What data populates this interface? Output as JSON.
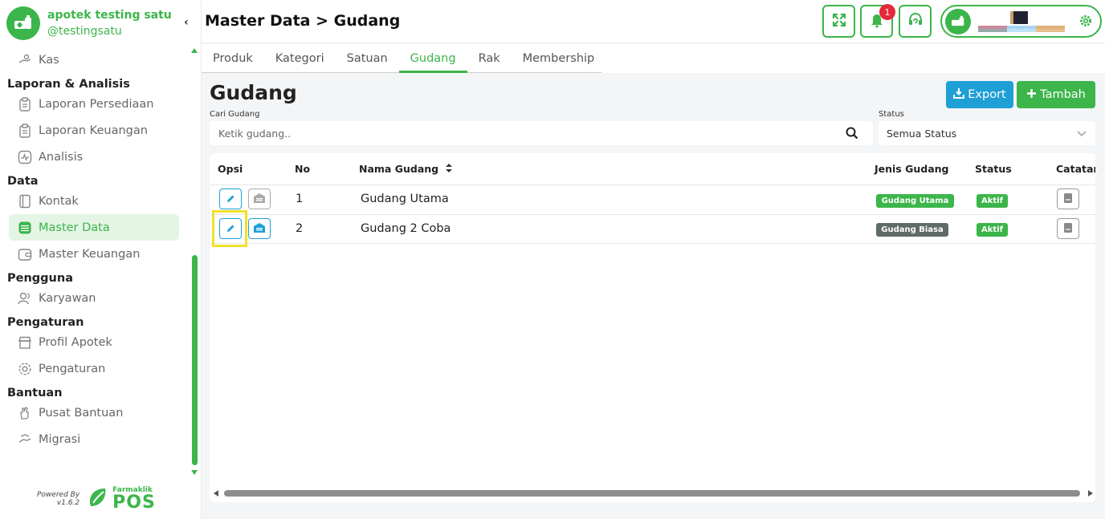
{
  "brand": {
    "name": "apotek testing satu",
    "handle": "@testingsatu"
  },
  "colors": {
    "accent": "#3cb54a",
    "blue": "#1e9fd6",
    "badge": "#e5293a",
    "highlight": "#f0e22b"
  },
  "sidebar": {
    "kas": "Kas",
    "laporan_section": "Laporan & Analisis",
    "laporan_persediaan": "Laporan Persediaan",
    "laporan_keuangan": "Laporan Keuangan",
    "analisis": "Analisis",
    "data_section": "Data",
    "kontak": "Kontak",
    "master_data": "Master Data",
    "master_keuangan": "Master Keuangan",
    "pengguna_section": "Pengguna",
    "karyawan": "Karyawan",
    "pengaturan_section": "Pengaturan",
    "profil_apotek": "Profil Apotek",
    "pengaturan": "Pengaturan",
    "bantuan_section": "Bantuan",
    "pusat_bantuan": "Pusat Bantuan",
    "migrasi": "Migrasi"
  },
  "powered": {
    "label": "Powered By",
    "version": "v1.6.2",
    "brand_small": "Farmaklik",
    "brand_big": "POS"
  },
  "header": {
    "title": "Master Data > Gudang",
    "notif_count": "1"
  },
  "tabs": [
    "Produk",
    "Kategori",
    "Satuan",
    "Gudang",
    "Rak",
    "Membership"
  ],
  "active_tab": "Gudang",
  "content": {
    "title": "Gudang",
    "export_label": "Export",
    "tambah_label": "Tambah",
    "search_label": "Cari Gudang",
    "search_placeholder": "Ketik gudang..",
    "status_label": "Status",
    "status_value": "Semua Status"
  },
  "table": {
    "headers": {
      "opsi": "Opsi",
      "no": "No",
      "nama": "Nama Gudang",
      "jenis": "Jenis Gudang",
      "status": "Status",
      "catatan": "Catatan"
    },
    "rows": [
      {
        "no": "1",
        "nama": "Gudang Utama",
        "jenis": "Gudang Utama",
        "status": "Aktif"
      },
      {
        "no": "2",
        "nama": "Gudang 2 Coba",
        "jenis": "Gudang Biasa",
        "status": "Aktif"
      }
    ]
  }
}
